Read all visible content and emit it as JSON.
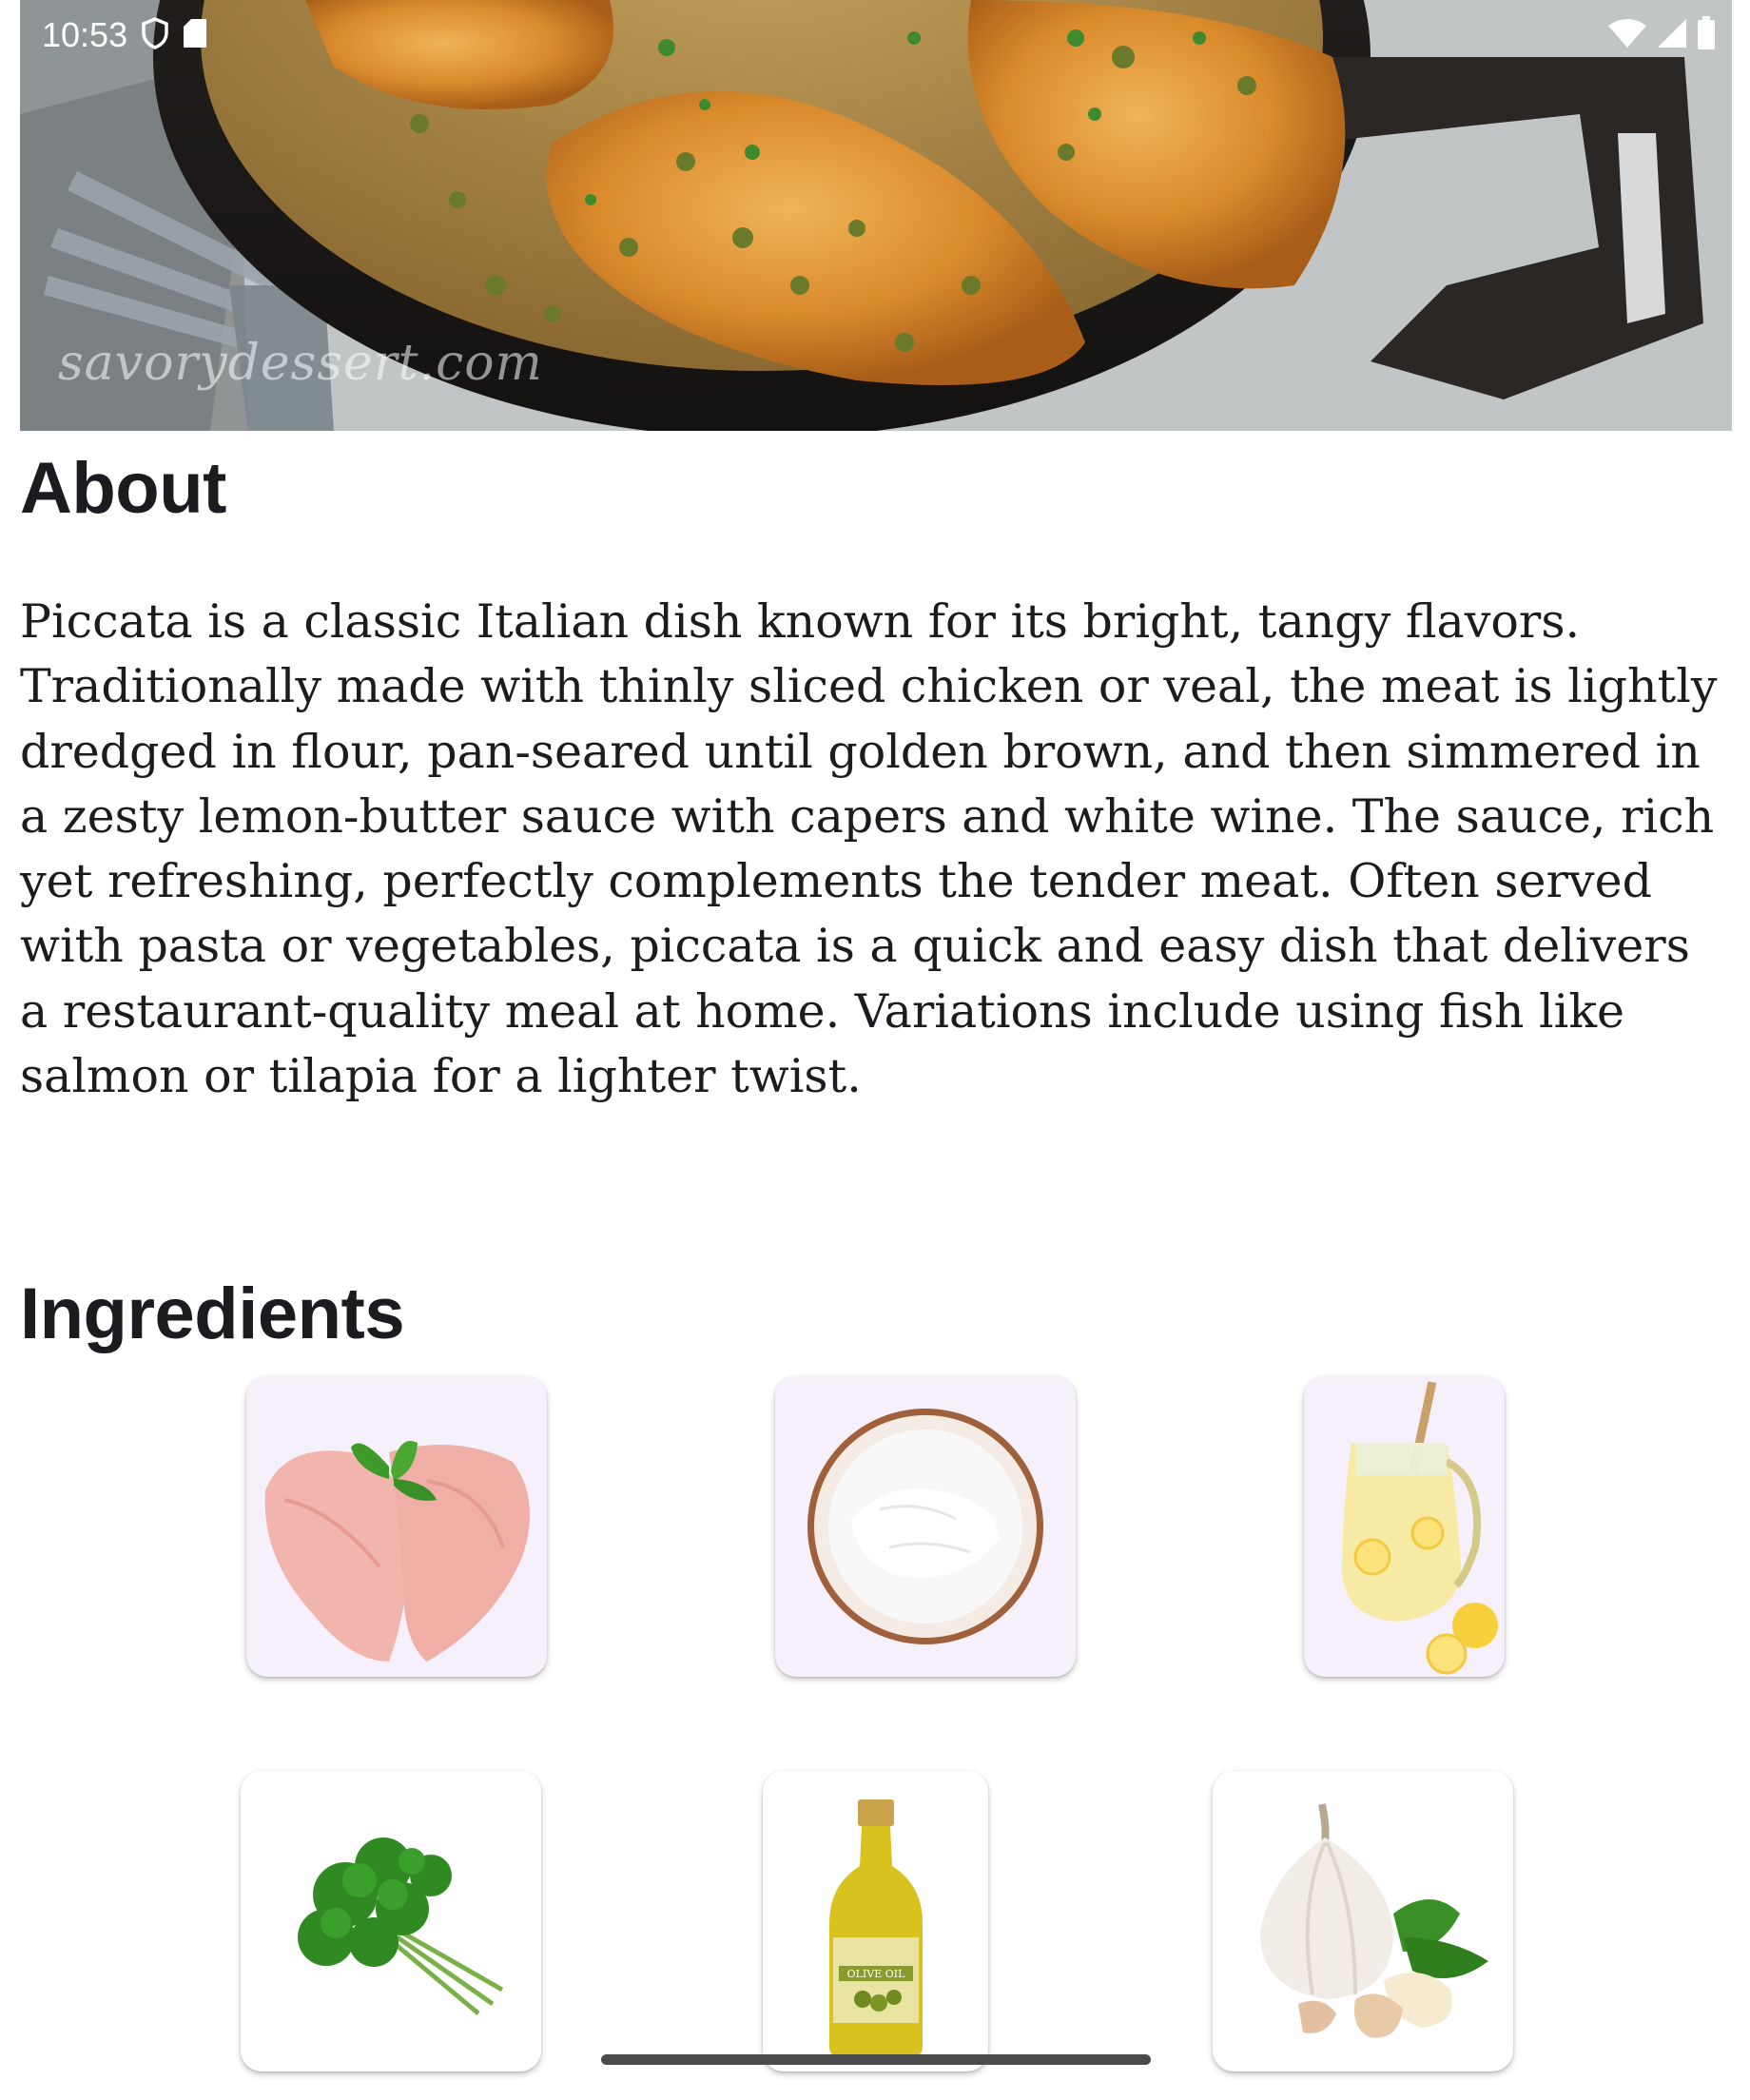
{
  "status_bar": {
    "time": "10:53",
    "left_icons": [
      "shield-icon",
      "sd-card-icon"
    ],
    "right_icons": [
      "wifi-icon",
      "cellular-signal-icon",
      "battery-icon"
    ]
  },
  "hero": {
    "image": "chicken-piccata-photo",
    "watermark": "savorydessert.com"
  },
  "about": {
    "title": "About",
    "text": "Piccata is a classic Italian dish known for its bright, tangy flavors. Traditionally made with thinly sliced chicken or veal, the meat is lightly dredged in flour, pan-seared until golden brown, and then simmered in a zesty lemon-butter sauce with capers and white wine. The sauce, rich yet refreshing, perfectly complements the tender meat. Often served with pasta or vegetables, piccata is a quick and easy dish that delivers a restaurant-quality meal at home. Variations include using fish like salmon or tilapia for a lighter twist."
  },
  "ingredients": {
    "title": "Ingredients",
    "items": [
      {
        "image": "chicken-breast-image"
      },
      {
        "image": "flour-bowl-image"
      },
      {
        "image": "lemon-juice-pitcher-image"
      },
      {
        "image": "parsley-bunch-image"
      },
      {
        "image": "olive-oil-bottle-image",
        "label": "OLIVE OIL"
      },
      {
        "image": "garlic-bulb-image"
      }
    ]
  },
  "colors": {
    "card_background": "#f5f0fa",
    "text": "#1c1b1f",
    "gesture_bar": "#4a4a4a"
  }
}
